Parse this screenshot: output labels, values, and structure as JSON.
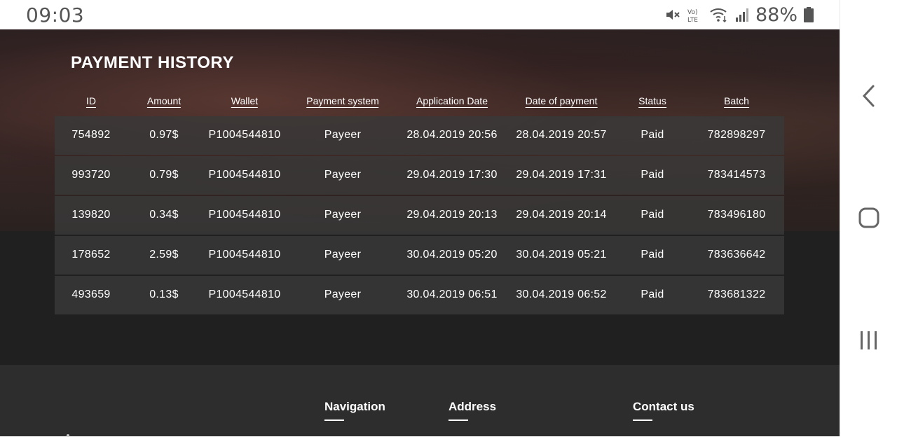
{
  "status_bar": {
    "time": "09:03",
    "battery": "88%",
    "icons": [
      "mute-icon",
      "volte-icon",
      "wifi-icon",
      "signal-icon",
      "battery-icon"
    ]
  },
  "page": {
    "title": "PAYMENT HISTORY"
  },
  "table": {
    "headers": [
      "ID",
      "Amount",
      "Wallet",
      "Payment system",
      "Application Date",
      "Date of payment",
      "Status",
      "Batch"
    ],
    "rows": [
      [
        "754892",
        "0.97$",
        "P1004544810",
        "Payeer",
        "28.04.2019 20:56",
        "28.04.2019 20:57",
        "Paid",
        "782898297"
      ],
      [
        "993720",
        "0.79$",
        "P1004544810",
        "Payeer",
        "29.04.2019 17:30",
        "29.04.2019 17:31",
        "Paid",
        "783414573"
      ],
      [
        "139820",
        "0.34$",
        "P1004544810",
        "Payeer",
        "29.04.2019 20:13",
        "29.04.2019 20:14",
        "Paid",
        "783496180"
      ],
      [
        "178652",
        "2.59$",
        "P1004544810",
        "Payeer",
        "30.04.2019 05:20",
        "30.04.2019 05:21",
        "Paid",
        "783636642"
      ],
      [
        "493659",
        "0.13$",
        "P1004544810",
        "Payeer",
        "30.04.2019 06:51",
        "30.04.2019 06:52",
        "Paid",
        "783681322"
      ]
    ]
  },
  "footer": {
    "navigation": "Navigation",
    "address": "Address",
    "contact": "Contact us"
  },
  "nav_bar": {
    "icons": [
      "back-icon",
      "home-icon",
      "recents-icon"
    ]
  }
}
